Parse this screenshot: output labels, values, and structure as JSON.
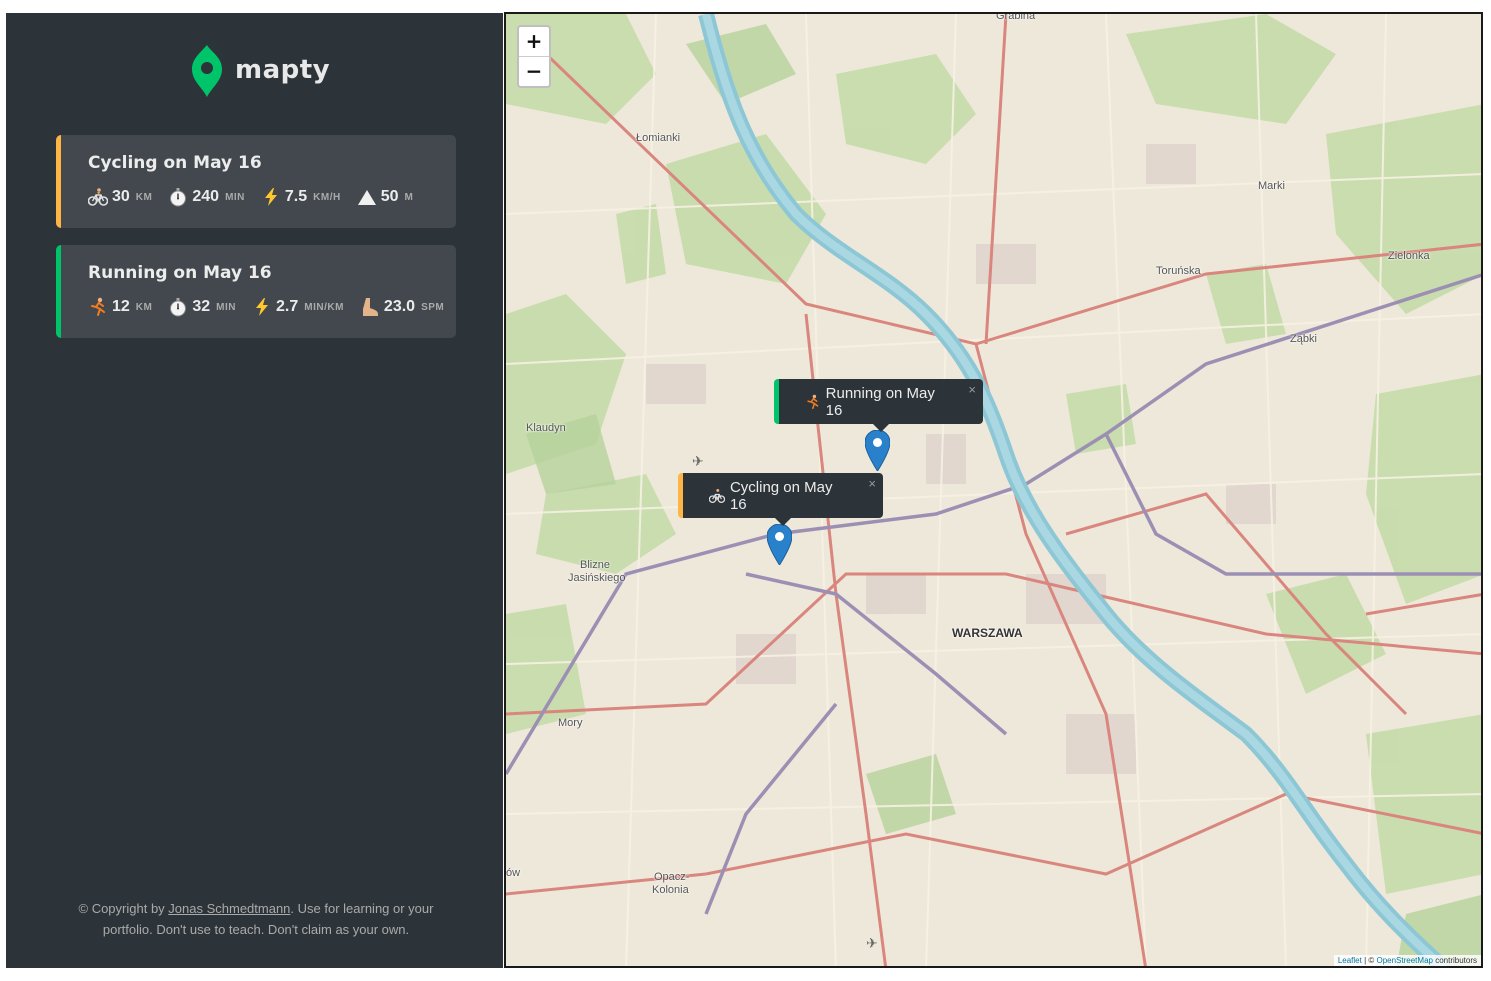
{
  "logo": {
    "text": "mapty",
    "icon": "map-pin-icon"
  },
  "workouts": [
    {
      "type": "cycling",
      "title": "Cycling on May 16",
      "accent": "#ffb545",
      "details": [
        {
          "icon": "bicycle-icon",
          "value": "30",
          "unit": "KM"
        },
        {
          "icon": "stopwatch-icon",
          "value": "240",
          "unit": "MIN"
        },
        {
          "icon": "lightning-icon",
          "value": "7.5",
          "unit": "KM/H"
        },
        {
          "icon": "mountain-icon",
          "value": "50",
          "unit": "M"
        }
      ]
    },
    {
      "type": "running",
      "title": "Running on May 16",
      "accent": "#00c46a",
      "details": [
        {
          "icon": "runner-icon",
          "value": "12",
          "unit": "KM"
        },
        {
          "icon": "stopwatch-icon",
          "value": "32",
          "unit": "MIN"
        },
        {
          "icon": "lightning-icon",
          "value": "2.7",
          "unit": "MIN/KM"
        },
        {
          "icon": "footprint-icon",
          "value": "23.0",
          "unit": "SPM"
        }
      ]
    }
  ],
  "footer": {
    "prefix": "© Copyright by ",
    "author": "Jonas Schmedtmann",
    "suffix": ". Use for learning or your portfolio. Don't use to teach. Don't claim as your own."
  },
  "map": {
    "zoom_in": "+",
    "zoom_out": "−",
    "popups": [
      {
        "text": "Running on May 16",
        "close": "×"
      },
      {
        "text": "Cycling on May 16",
        "close": "×"
      }
    ],
    "places": {
      "grabina": "Grabina",
      "lomianki": "Łomianki",
      "marki": "Marki",
      "torunska": "Toruńska",
      "zielonka": "Zielonka",
      "zabki": "Ząbki",
      "klaudyn": "Klaudyn",
      "blizne_1": "Blizne",
      "blizne_2": "Jasińskiego",
      "warszawa": "WARSZAWA",
      "mory": "Mory",
      "opacz_1": "Opacz-",
      "opacz_2": "Kolonia",
      "ow": "ów"
    },
    "attribution": {
      "leaflet": "Leaflet",
      "sep": " | © ",
      "osm": "OpenStreetMap",
      "suffix": " contributors"
    }
  },
  "colors": {
    "sidebar_bg": "#2d3439",
    "card_bg": "#42484d",
    "cycling": "#ffb545",
    "running": "#00c46a",
    "river": "#7fc8d6",
    "marker": "#2a81cb"
  }
}
